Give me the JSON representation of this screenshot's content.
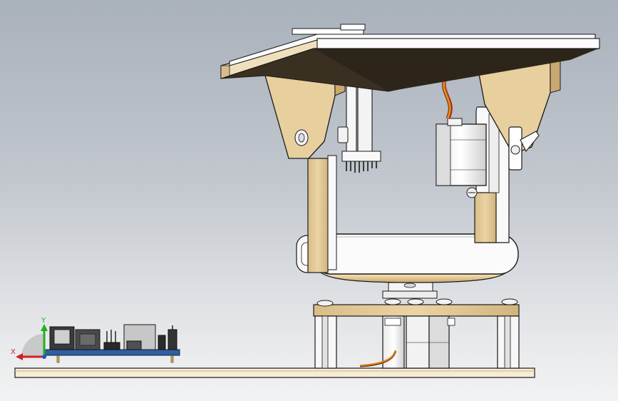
{
  "viewport": {
    "background_top": "#a9b1bb",
    "background_bottom": "#f2f3f4"
  },
  "model": {
    "parts": [
      "base-plate",
      "lower-bracket",
      "lower-servo",
      "turntable-bearing",
      "pan-ring",
      "upright-left",
      "upright-right",
      "upper-servo",
      "servo-horn",
      "cable",
      "top-plate",
      "gusset-left",
      "gusset-right",
      "comb-sensor",
      "controller-board"
    ],
    "colors": {
      "wood": "#e7cf9f",
      "wood_dark": "#c9a971",
      "white_part": "#fafafa",
      "outline": "#1a1a1a",
      "top_plate_shadow": "#3a3022",
      "pcb_blue": "#2f5fa0",
      "cable_orange": "#e8891e",
      "cable_red": "#c8302a"
    }
  },
  "triad": {
    "x_label": "X",
    "y_label": "Y",
    "x_color": "#d42020",
    "y_color": "#1fb020",
    "z_color": "#2050d0"
  }
}
